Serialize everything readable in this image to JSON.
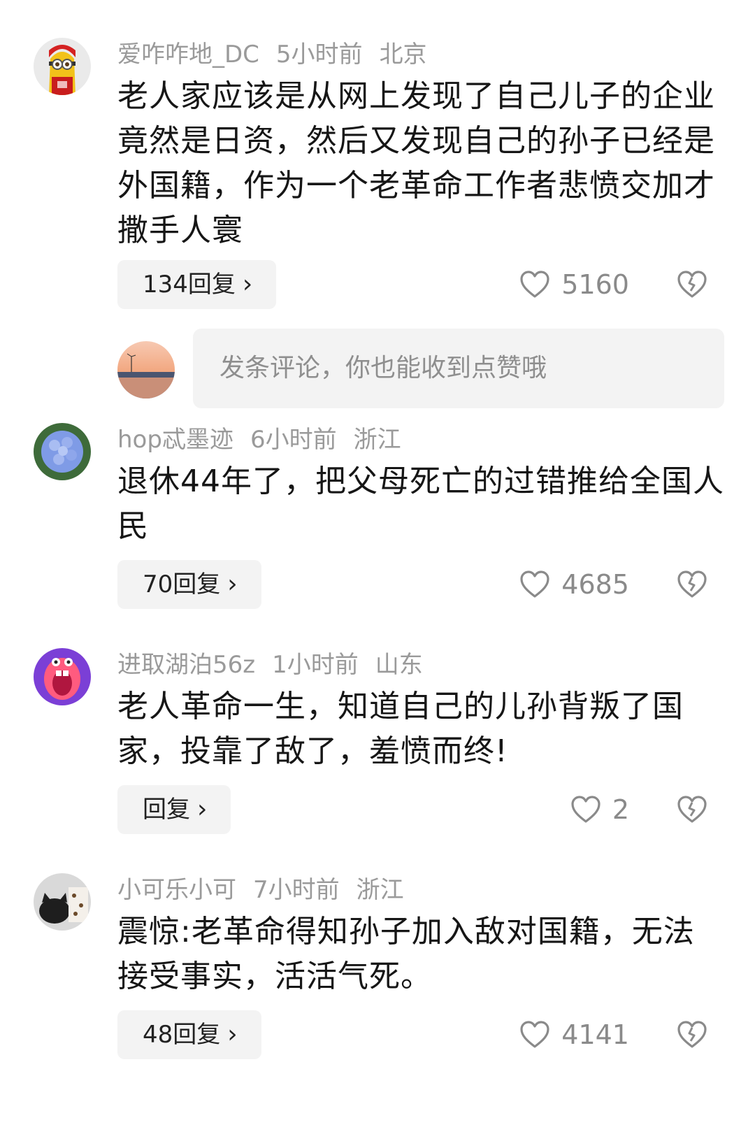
{
  "comments": [
    {
      "username": "爱咋咋地_DC",
      "time": "5小时前",
      "location": "北京",
      "text": "老人家应该是从网上发现了自己儿子的企业竟然是日资，然后又发现自己的孙子已经是外国籍，作为一个老革命工作者悲愤交加才撒手人寰",
      "reply_label": "134回复",
      "likes": "5160",
      "avatar_icon": "minion-avatar"
    },
    {
      "username": "hop忒墨迹",
      "time": "6小时前",
      "location": "浙江",
      "text": "退休44年了，把父母死亡的过错推给全国人民",
      "reply_label": "70回复",
      "likes": "4685",
      "avatar_icon": "hydrangea-avatar"
    },
    {
      "username": "进取湖泊56z",
      "time": "1小时前",
      "location": "山东",
      "text": "老人革命一生，知道自己的儿孙背叛了国家，投靠了敌了，羞愤而终!",
      "reply_label": "回复",
      "likes": "2",
      "avatar_icon": "cartoon-mouth-avatar"
    },
    {
      "username": "小可乐小可",
      "time": "7小时前",
      "location": "浙江",
      "text": "震惊:老革命得知孙子加入敌对国籍，无法接受事实，活活气死。",
      "reply_label": "48回复",
      "likes": "4141",
      "avatar_icon": "cat-avatar"
    }
  ],
  "compose": {
    "placeholder": "发条评论，你也能收到点赞哦"
  },
  "icons": {
    "like": "heart-outline-icon",
    "dislike": "broken-heart-icon",
    "chevron": "chevron-right-icon"
  },
  "colors": {
    "meta_gray": "#9a9a9a",
    "button_bg": "#f3f3f3",
    "text": "#161616"
  }
}
